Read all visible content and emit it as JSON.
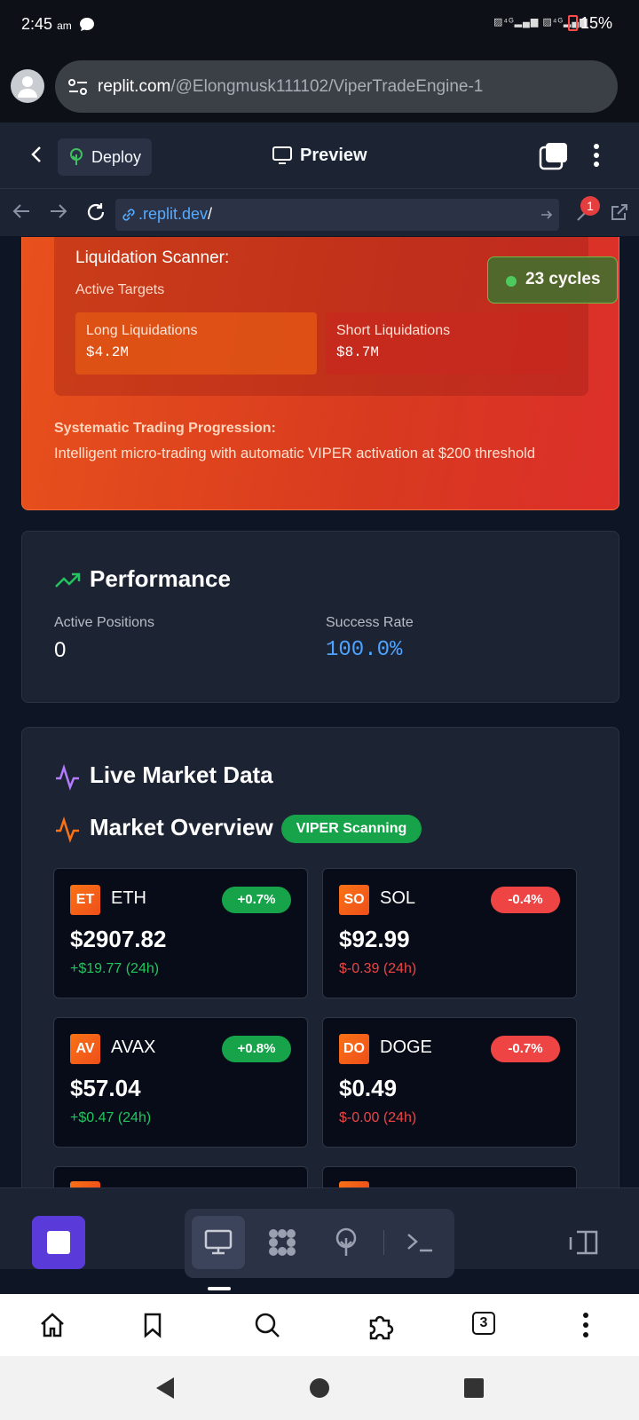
{
  "status_bar": {
    "time": "2:45",
    "ampm": "am",
    "network": "4G 4G",
    "battery": "15%"
  },
  "browser": {
    "url_host": "replit.com",
    "url_path": "/@Elongmusk111102/ViperTradeEngine-1",
    "tab_count": "3"
  },
  "replit_header": {
    "deploy_label": "Deploy",
    "preview_label": "Preview"
  },
  "preview_nav": {
    "url_prefix": ".replit.dev",
    "url_suffix": "/",
    "badge_count": "1"
  },
  "hero": {
    "scanner_title": "Liquidation Scanner:",
    "scanner_subtitle": "Active Targets",
    "long": {
      "label": "Long Liquidations",
      "value": "$4.2M"
    },
    "short": {
      "label": "Short Liquidations",
      "value": "$8.7M"
    },
    "progression_title": "Systematic Trading Progression:",
    "progression_text": "Intelligent micro-trading with automatic VIPER activation at $200 threshold"
  },
  "cycles_badge": "23 cycles",
  "performance": {
    "title": "Performance",
    "active_positions_label": "Active Positions",
    "active_positions_value": "0",
    "success_rate_label": "Success Rate",
    "success_rate_value": "100.0%"
  },
  "market": {
    "live_title": "Live Market Data",
    "overview_title": "Market Overview",
    "badge": "VIPER Scanning",
    "coins": [
      {
        "abbr": "ET",
        "name": "ETH",
        "change": "+0.7%",
        "price": "$2907.82",
        "delta": "+$19.77 (24h)"
      },
      {
        "abbr": "SO",
        "name": "SOL",
        "change": "-0.4%",
        "price": "$92.99",
        "delta": "$-0.39 (24h)"
      },
      {
        "abbr": "AV",
        "name": "AVAX",
        "change": "+0.8%",
        "price": "$57.04",
        "delta": "+$0.47 (24h)"
      },
      {
        "abbr": "DO",
        "name": "DOGE",
        "change": "-0.7%",
        "price": "$0.49",
        "delta": "$-0.00 (24h)"
      }
    ]
  },
  "colors": {
    "up": "#22c55e",
    "down": "#ef4444",
    "accent": "#5a3bd9",
    "link": "#57abff"
  }
}
